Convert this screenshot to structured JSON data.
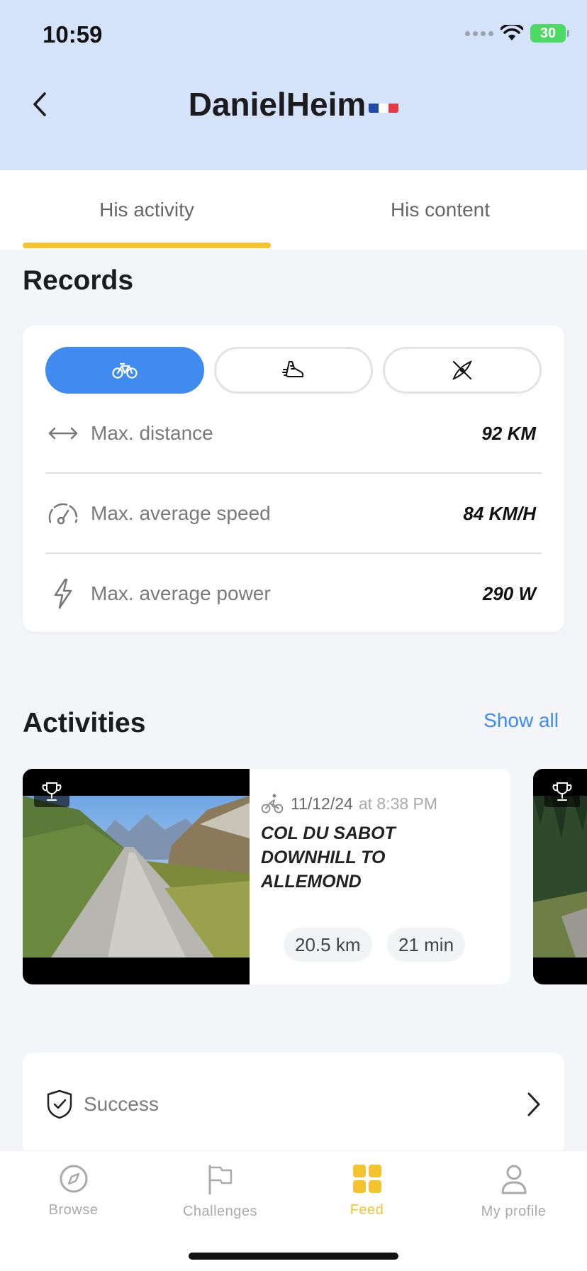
{
  "status_bar": {
    "time": "10:59",
    "battery": "30"
  },
  "header": {
    "title": "DanielHeim",
    "flag": "french-flag"
  },
  "tabs": [
    {
      "label": "His activity",
      "active": true
    },
    {
      "label": "His content",
      "active": false
    }
  ],
  "records": {
    "title": "Records",
    "sports": [
      {
        "icon": "bike-icon",
        "active": true
      },
      {
        "icon": "running-shoe-icon",
        "active": false
      },
      {
        "icon": "kayak-icon",
        "active": false
      }
    ],
    "rows": [
      {
        "icon": "distance-arrows-icon",
        "label": "Max. distance",
        "value": "92 KM"
      },
      {
        "icon": "speedometer-icon",
        "label": "Max. average speed",
        "value": "84 KM/H"
      },
      {
        "icon": "lightning-icon",
        "label": "Max. average power",
        "value": "290 W"
      }
    ]
  },
  "activities": {
    "title": "Activities",
    "show_all": "Show all",
    "items": [
      {
        "date": "11/12/24",
        "time": "at 8:38 PM",
        "title": "COL DU SABOT DOWNHILL TO ALLEMOND",
        "distance": "20.5 km",
        "duration": "21 min"
      }
    ]
  },
  "success": {
    "label": "Success"
  },
  "bottom_nav": [
    {
      "label": "Browse",
      "icon": "compass-icon",
      "active": false
    },
    {
      "label": "Challenges",
      "icon": "flag-icon",
      "active": false
    },
    {
      "label": "Feed",
      "icon": "feed-grid-icon",
      "active": true
    },
    {
      "label": "My profile",
      "icon": "person-icon",
      "active": false
    }
  ],
  "colors": {
    "header_bg": "#d4e3fa",
    "accent_blue": "#3f8bef",
    "accent_yellow": "#f4c430"
  }
}
